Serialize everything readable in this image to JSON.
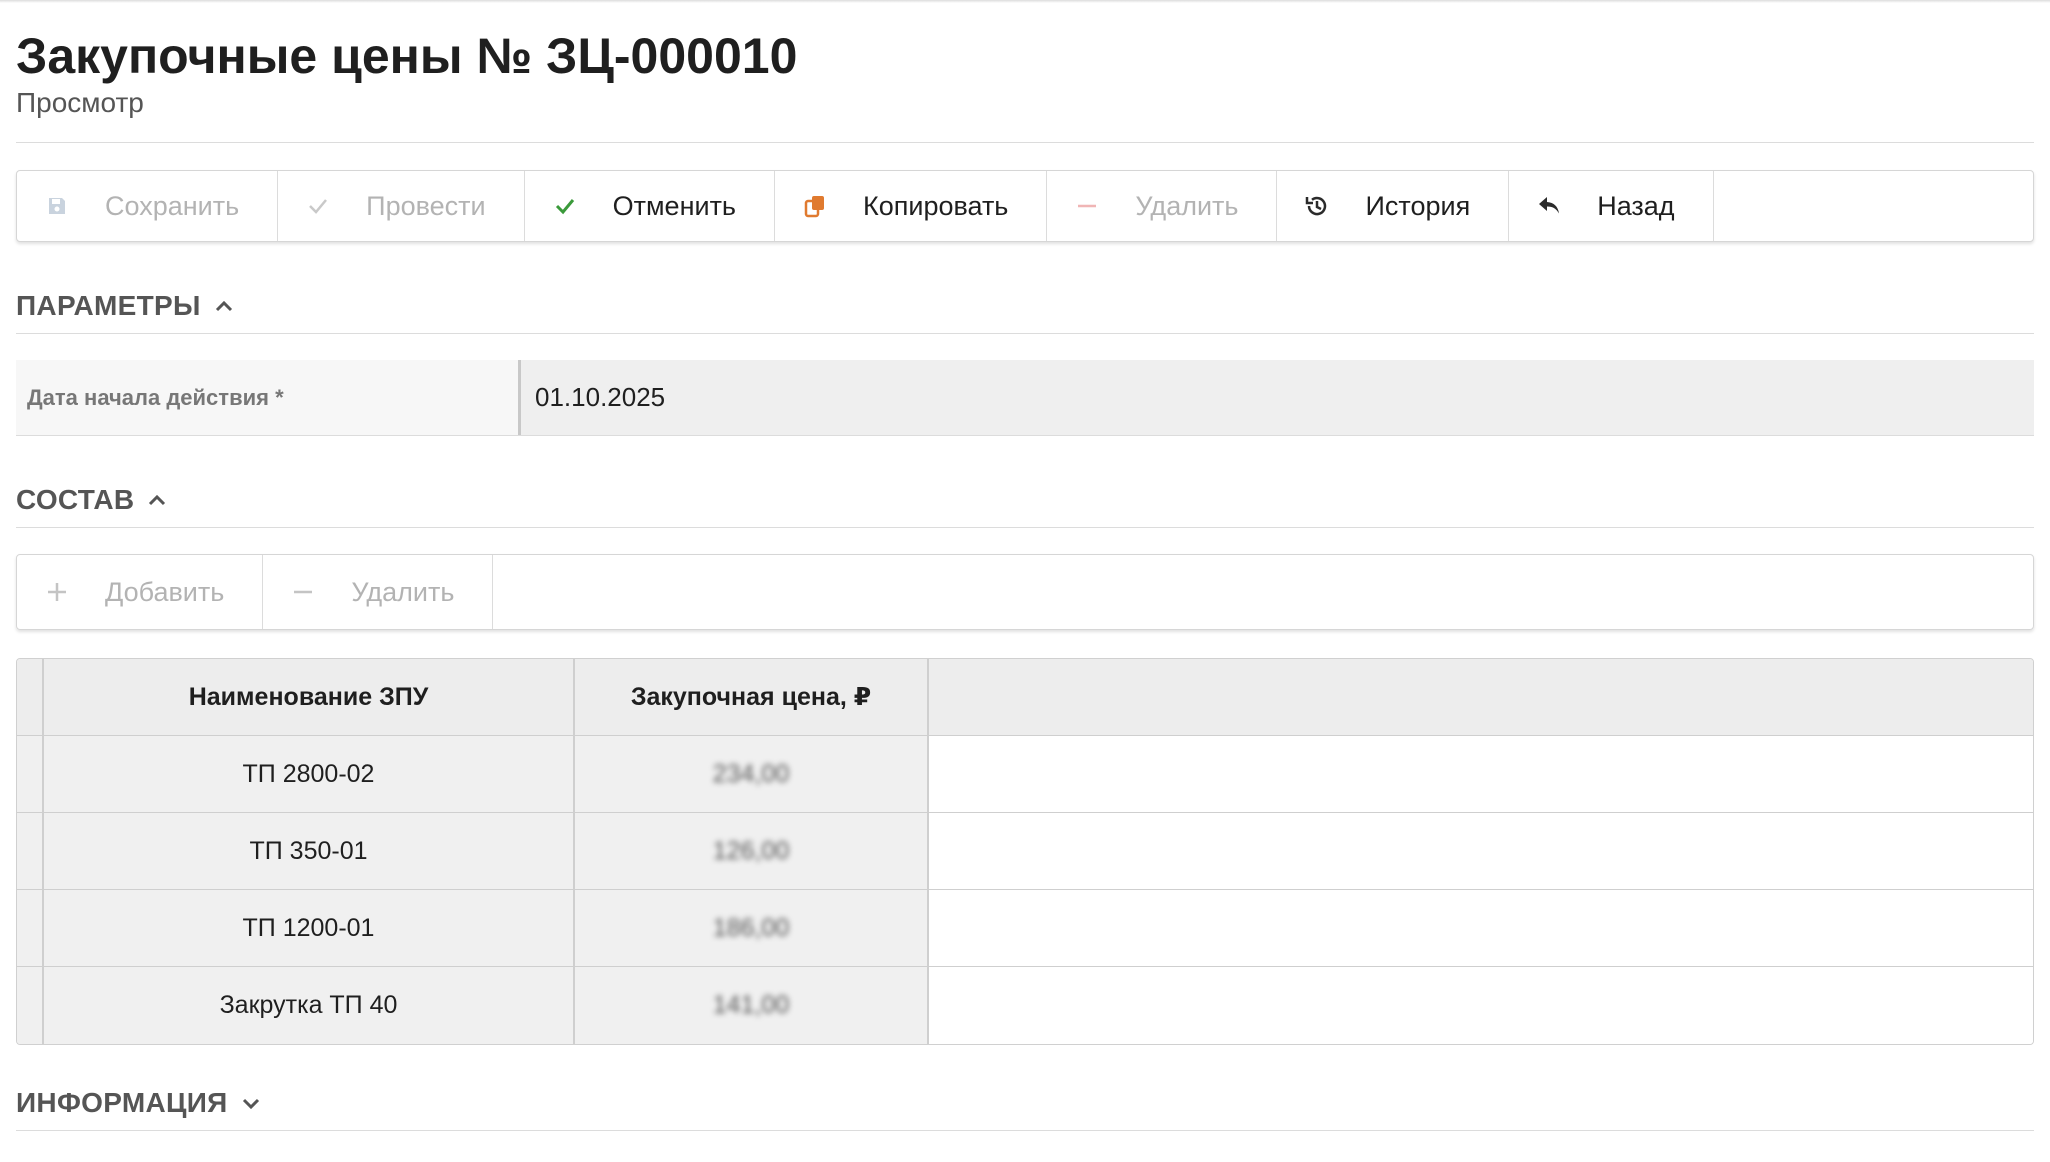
{
  "page": {
    "title": "Закупочные цены № ЗЦ-000010",
    "subtitle": "Просмотр"
  },
  "toolbar": {
    "save": "Сохранить",
    "post": "Провести",
    "cancel": "Отменить",
    "copy": "Копировать",
    "delete": "Удалить",
    "history": "История",
    "back": "Назад"
  },
  "sections": {
    "params": "ПАРАМЕТРЫ",
    "composition": "СОСТАВ",
    "info": "ИНФОРМАЦИЯ"
  },
  "params": {
    "start_date_label": "Дата начала действия *",
    "start_date_value": "01.10.2025"
  },
  "composition_toolbar": {
    "add": "Добавить",
    "delete": "Удалить"
  },
  "table": {
    "headers": [
      "Наименование ЗПУ",
      "Закупочная цена, ₽"
    ],
    "rows": [
      {
        "name": "ТП 2800-02",
        "price": "234,00"
      },
      {
        "name": "ТП 350-01",
        "price": "126,00"
      },
      {
        "name": "ТП 1200-01",
        "price": "186,00"
      },
      {
        "name": "Закрутка ТП 40",
        "price": "141,00"
      }
    ]
  },
  "colors": {
    "accent_green": "#3a9a3a",
    "copy_orange": "#e07a2f",
    "disabled": "#b3b3b3"
  }
}
